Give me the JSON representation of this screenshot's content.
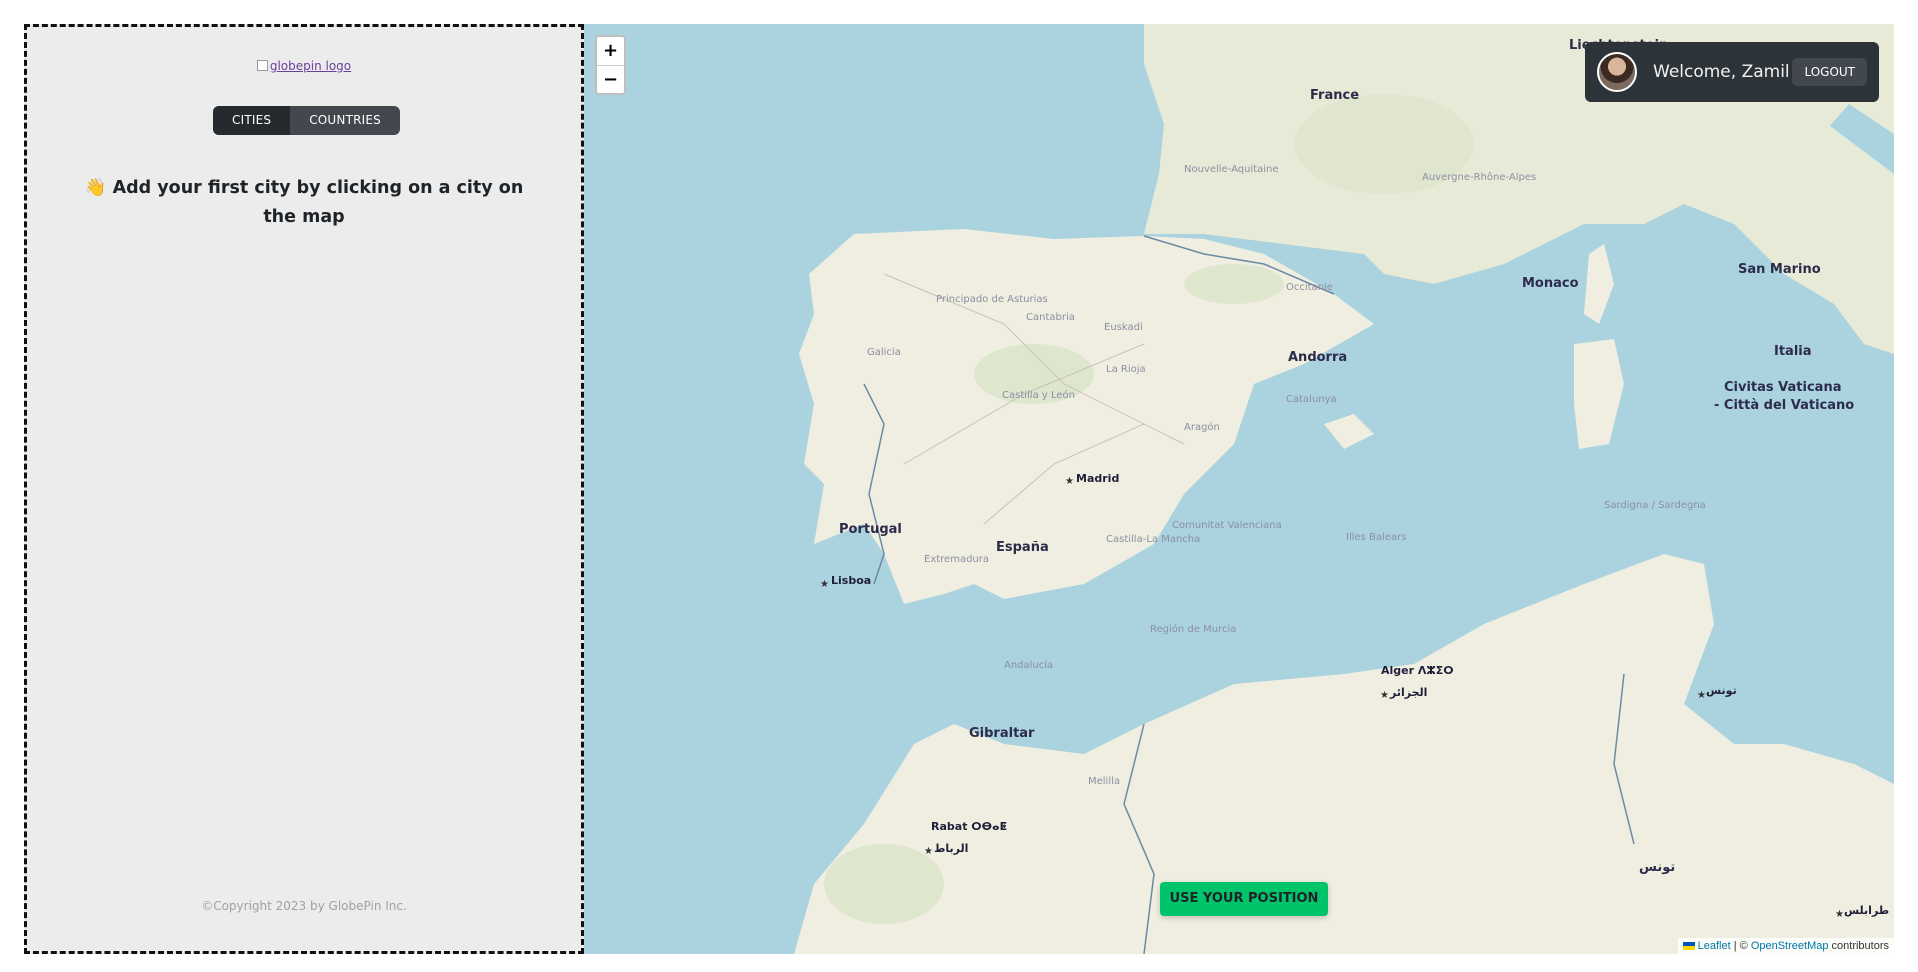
{
  "sidebar": {
    "logo_alt": "globepin logo",
    "tabs": [
      {
        "label": "CITIES",
        "active": true
      },
      {
        "label": "COUNTRIES",
        "active": false
      }
    ],
    "empty_message": "👋 Add your first city by clicking on a city on the map",
    "copyright": "©Copyright 2023 by GlobePin Inc."
  },
  "map": {
    "zoom_in": "+",
    "zoom_out": "−",
    "use_position": "USE YOUR POSITION",
    "attribution": {
      "leaflet": "Leaflet",
      "separator": " | © ",
      "osm": "OpenStreetMap",
      "suffix": " contributors"
    },
    "labels": {
      "france": "France",
      "andorra": "Andorra",
      "monaco": "Monaco",
      "san_marino": "San Marino",
      "italia": "Italia",
      "vatican_1": "Civitas Vaticana",
      "vatican_2": "- Città del Vaticano",
      "espana": "España",
      "portugal": "Portugal",
      "madrid": "Madrid",
      "lisboa": "Lisboa",
      "gibraltar": "Gibraltar",
      "alger": "Alger ⴷⵣⵉⵔ",
      "alger_ar": "الجزائر",
      "rabat": "Rabat ⵔⴱⴰⵟ",
      "rabat_ar": "الرباط",
      "tunis_ar": "تونس",
      "tunisia_ar": "تونس",
      "tripoli_ar": "طرابلس",
      "liechtenstein": "Liechtenstein",
      "sardegna": "Sardigna / Sardegna",
      "illes_balears": "Illes Balears",
      "galicia": "Galicia",
      "andalucia": "Andalucía",
      "extremadura": "Extremadura",
      "aragon": "Aragón",
      "catalunya": "Catalunya",
      "occitanie": "Occitanie",
      "nouvelle_aquitaine": "Nouvelle-Aquitaine",
      "auvergne": "Auvergne-Rhône-Alpes",
      "melilla": "Melilla",
      "castilla_leon": "Castilla y León",
      "castilla_mancha": "Castilla-La Mancha",
      "comunitat_valenciana": "Comunitat Valenciana",
      "region_murcia": "Región de Murcia",
      "principado": "Principado de Asturias",
      "cantabria": "Cantabria",
      "euskadi": "Euskadi",
      "la_rioja": "La Rioja"
    }
  },
  "user": {
    "welcome": "Welcome, Zamil",
    "logout": "LOGOUT"
  },
  "colors": {
    "sea": "#aad3df",
    "land": "#f2efe9",
    "accent_green": "#00c46a",
    "dark": "#2d3439"
  }
}
